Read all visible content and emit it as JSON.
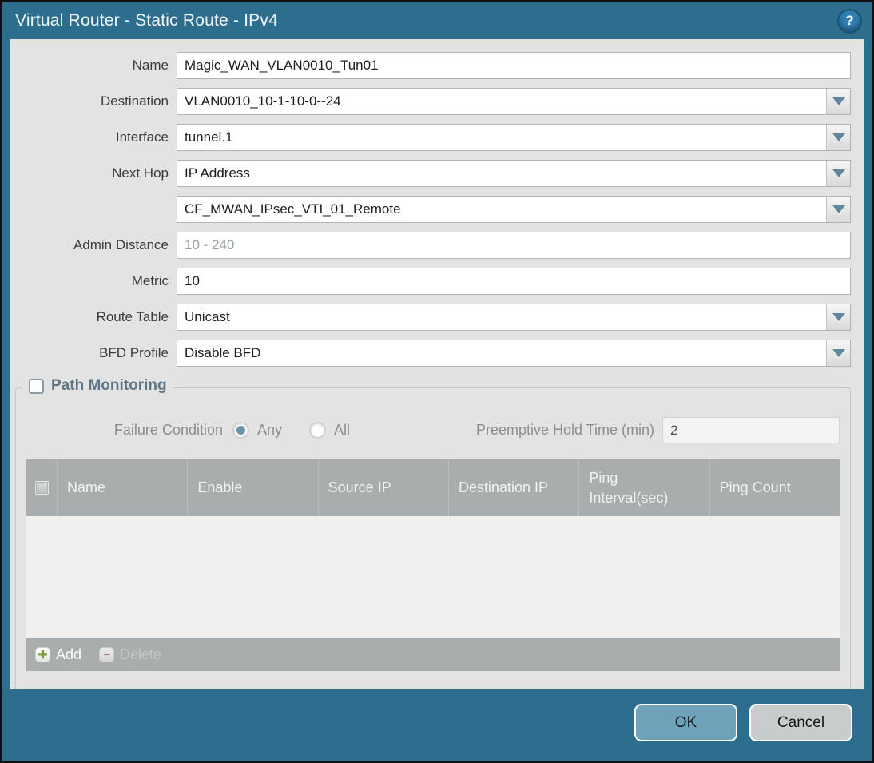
{
  "window": {
    "title": "Virtual Router - Static Route - IPv4"
  },
  "icons": {
    "help": "?",
    "add": "✚",
    "delete": "−"
  },
  "form": {
    "name": {
      "label": "Name",
      "value": "Magic_WAN_VLAN0010_Tun01"
    },
    "destination": {
      "label": "Destination",
      "value": "VLAN0010_10-1-10-0--24"
    },
    "interface": {
      "label": "Interface",
      "value": "tunnel.1"
    },
    "next_hop": {
      "label": "Next Hop",
      "value": "IP Address"
    },
    "next_hop_address": {
      "value": "CF_MWAN_IPsec_VTI_01_Remote"
    },
    "admin_distance": {
      "label": "Admin Distance",
      "value": "",
      "placeholder": "10 - 240"
    },
    "metric": {
      "label": "Metric",
      "value": "10"
    },
    "route_table": {
      "label": "Route Table",
      "value": "Unicast"
    },
    "bfd_profile": {
      "label": "BFD Profile",
      "value": "Disable BFD"
    }
  },
  "path_monitoring": {
    "legend": "Path Monitoring",
    "enabled": false,
    "failure_condition": {
      "label": "Failure Condition",
      "options": [
        "Any",
        "All"
      ],
      "selected": "Any"
    },
    "preemptive_hold_time": {
      "label": "Preemptive Hold Time (min)",
      "value": "2"
    },
    "table": {
      "columns": [
        "Name",
        "Enable",
        "Source IP",
        "Destination IP",
        "Ping Interval(sec)",
        "Ping Count"
      ],
      "rows": [],
      "add_label": "Add",
      "delete_label": "Delete"
    }
  },
  "footer": {
    "ok_label": "OK",
    "cancel_label": "Cancel"
  },
  "colors": {
    "frame_teal": "#2d6e8e",
    "content_bg": "#e3e3e3",
    "table_header_bg": "#a9adad",
    "ok_button_bg": "#6da2b8",
    "cancel_button_bg": "#c9cccc",
    "legend_text": "#5d7585",
    "radio_selected": "#6b93a8"
  }
}
